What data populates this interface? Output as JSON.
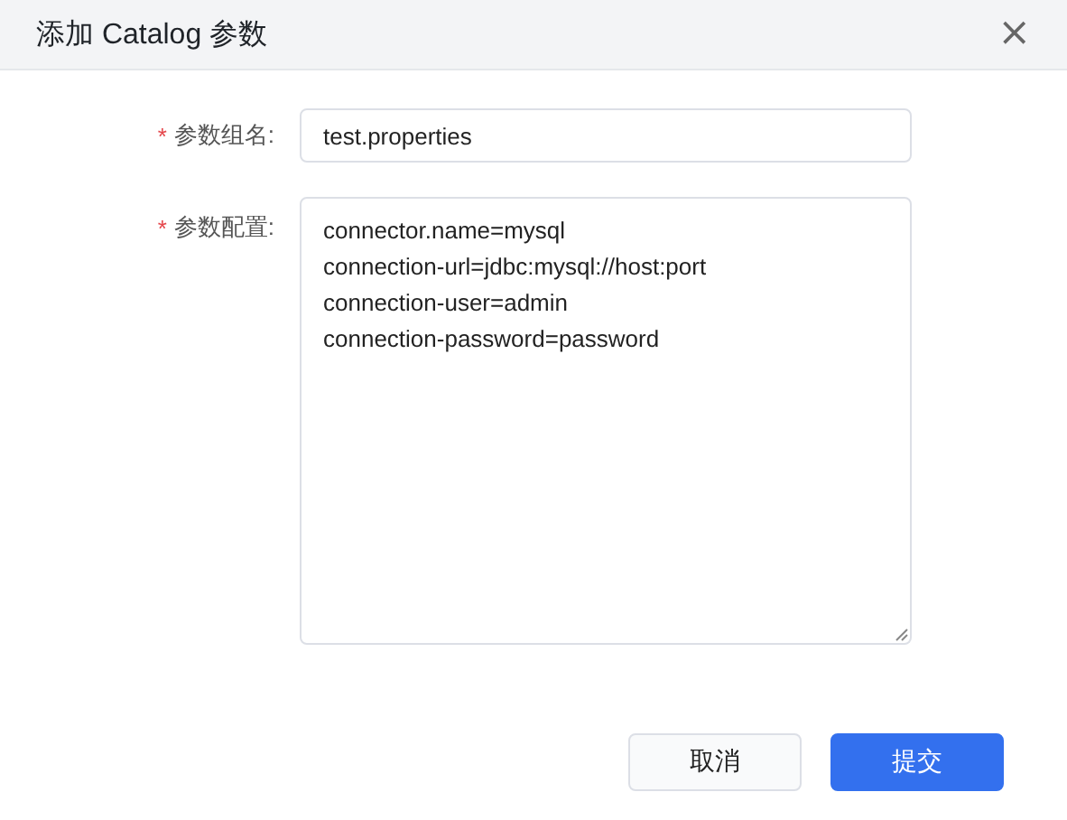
{
  "dialog": {
    "title": "添加 Catalog 参数",
    "close_icon": "×"
  },
  "fields": [
    {
      "kind": "input",
      "required_mark": "*",
      "label": "参数组名:",
      "value": "test.properties"
    },
    {
      "kind": "textarea",
      "required_mark": "*",
      "label": "参数配置:",
      "value": "connector.name=mysql\nconnection-url=jdbc:mysql://host:port\nconnection-user=admin\nconnection-password=password"
    }
  ],
  "buttons": [
    {
      "label": "取消",
      "kind": "default"
    },
    {
      "label": "提交",
      "kind": "primary"
    }
  ]
}
